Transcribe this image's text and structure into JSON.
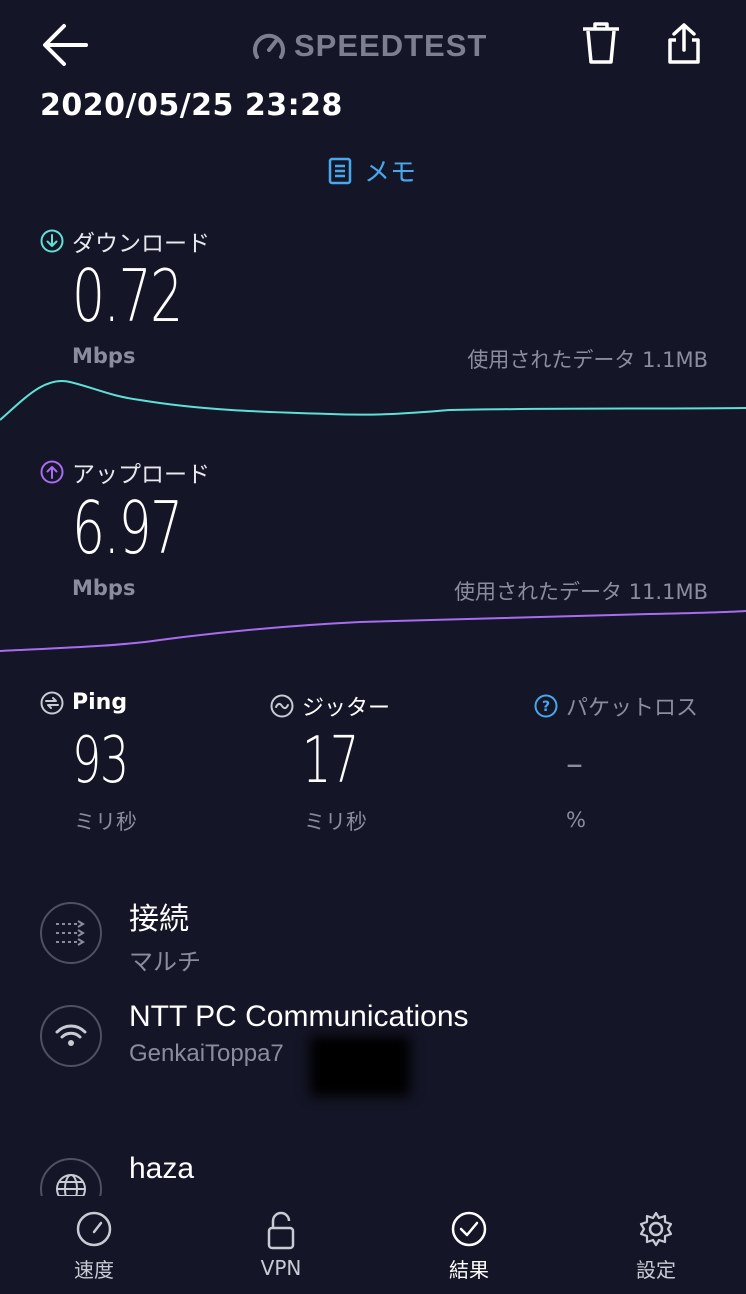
{
  "header": {
    "logo_text": "SPEEDTEST",
    "datetime": "2020/05/25 23:28",
    "memo_label": "メモ",
    "icons": [
      "back-arrow-icon",
      "trash-icon",
      "share-icon",
      "gauge-icon"
    ]
  },
  "download": {
    "label": "ダウンロード",
    "value": "0.72",
    "unit": "Mbps",
    "data_used": "使用されたデータ 1.1MB",
    "color": "#5ee0d8"
  },
  "upload": {
    "label": "アップロード",
    "value": "6.97",
    "unit": "Mbps",
    "data_used": "使用されたデータ 11.1MB",
    "color": "#a86cf0"
  },
  "ping": {
    "label": "Ping",
    "value": "93",
    "unit": "ミリ秒"
  },
  "jitter": {
    "label": "ジッター",
    "value": "17",
    "unit": "ミリ秒"
  },
  "packet_loss": {
    "label": "パケットロス",
    "value": "–",
    "unit": "%",
    "accent": "#47a8ee"
  },
  "connection": {
    "title": "接続",
    "value": "マルチ"
  },
  "provider": {
    "title": "NTT PC Communications",
    "value": "GenkaiToppa7"
  },
  "server": {
    "title": "haza"
  },
  "tabs": [
    {
      "label": "速度",
      "icon": "speedometer-icon"
    },
    {
      "label": "VPN",
      "icon": "lock-icon"
    },
    {
      "label": "結果",
      "icon": "check-circle-icon",
      "active": true
    },
    {
      "label": "設定",
      "icon": "gear-icon"
    }
  ]
}
